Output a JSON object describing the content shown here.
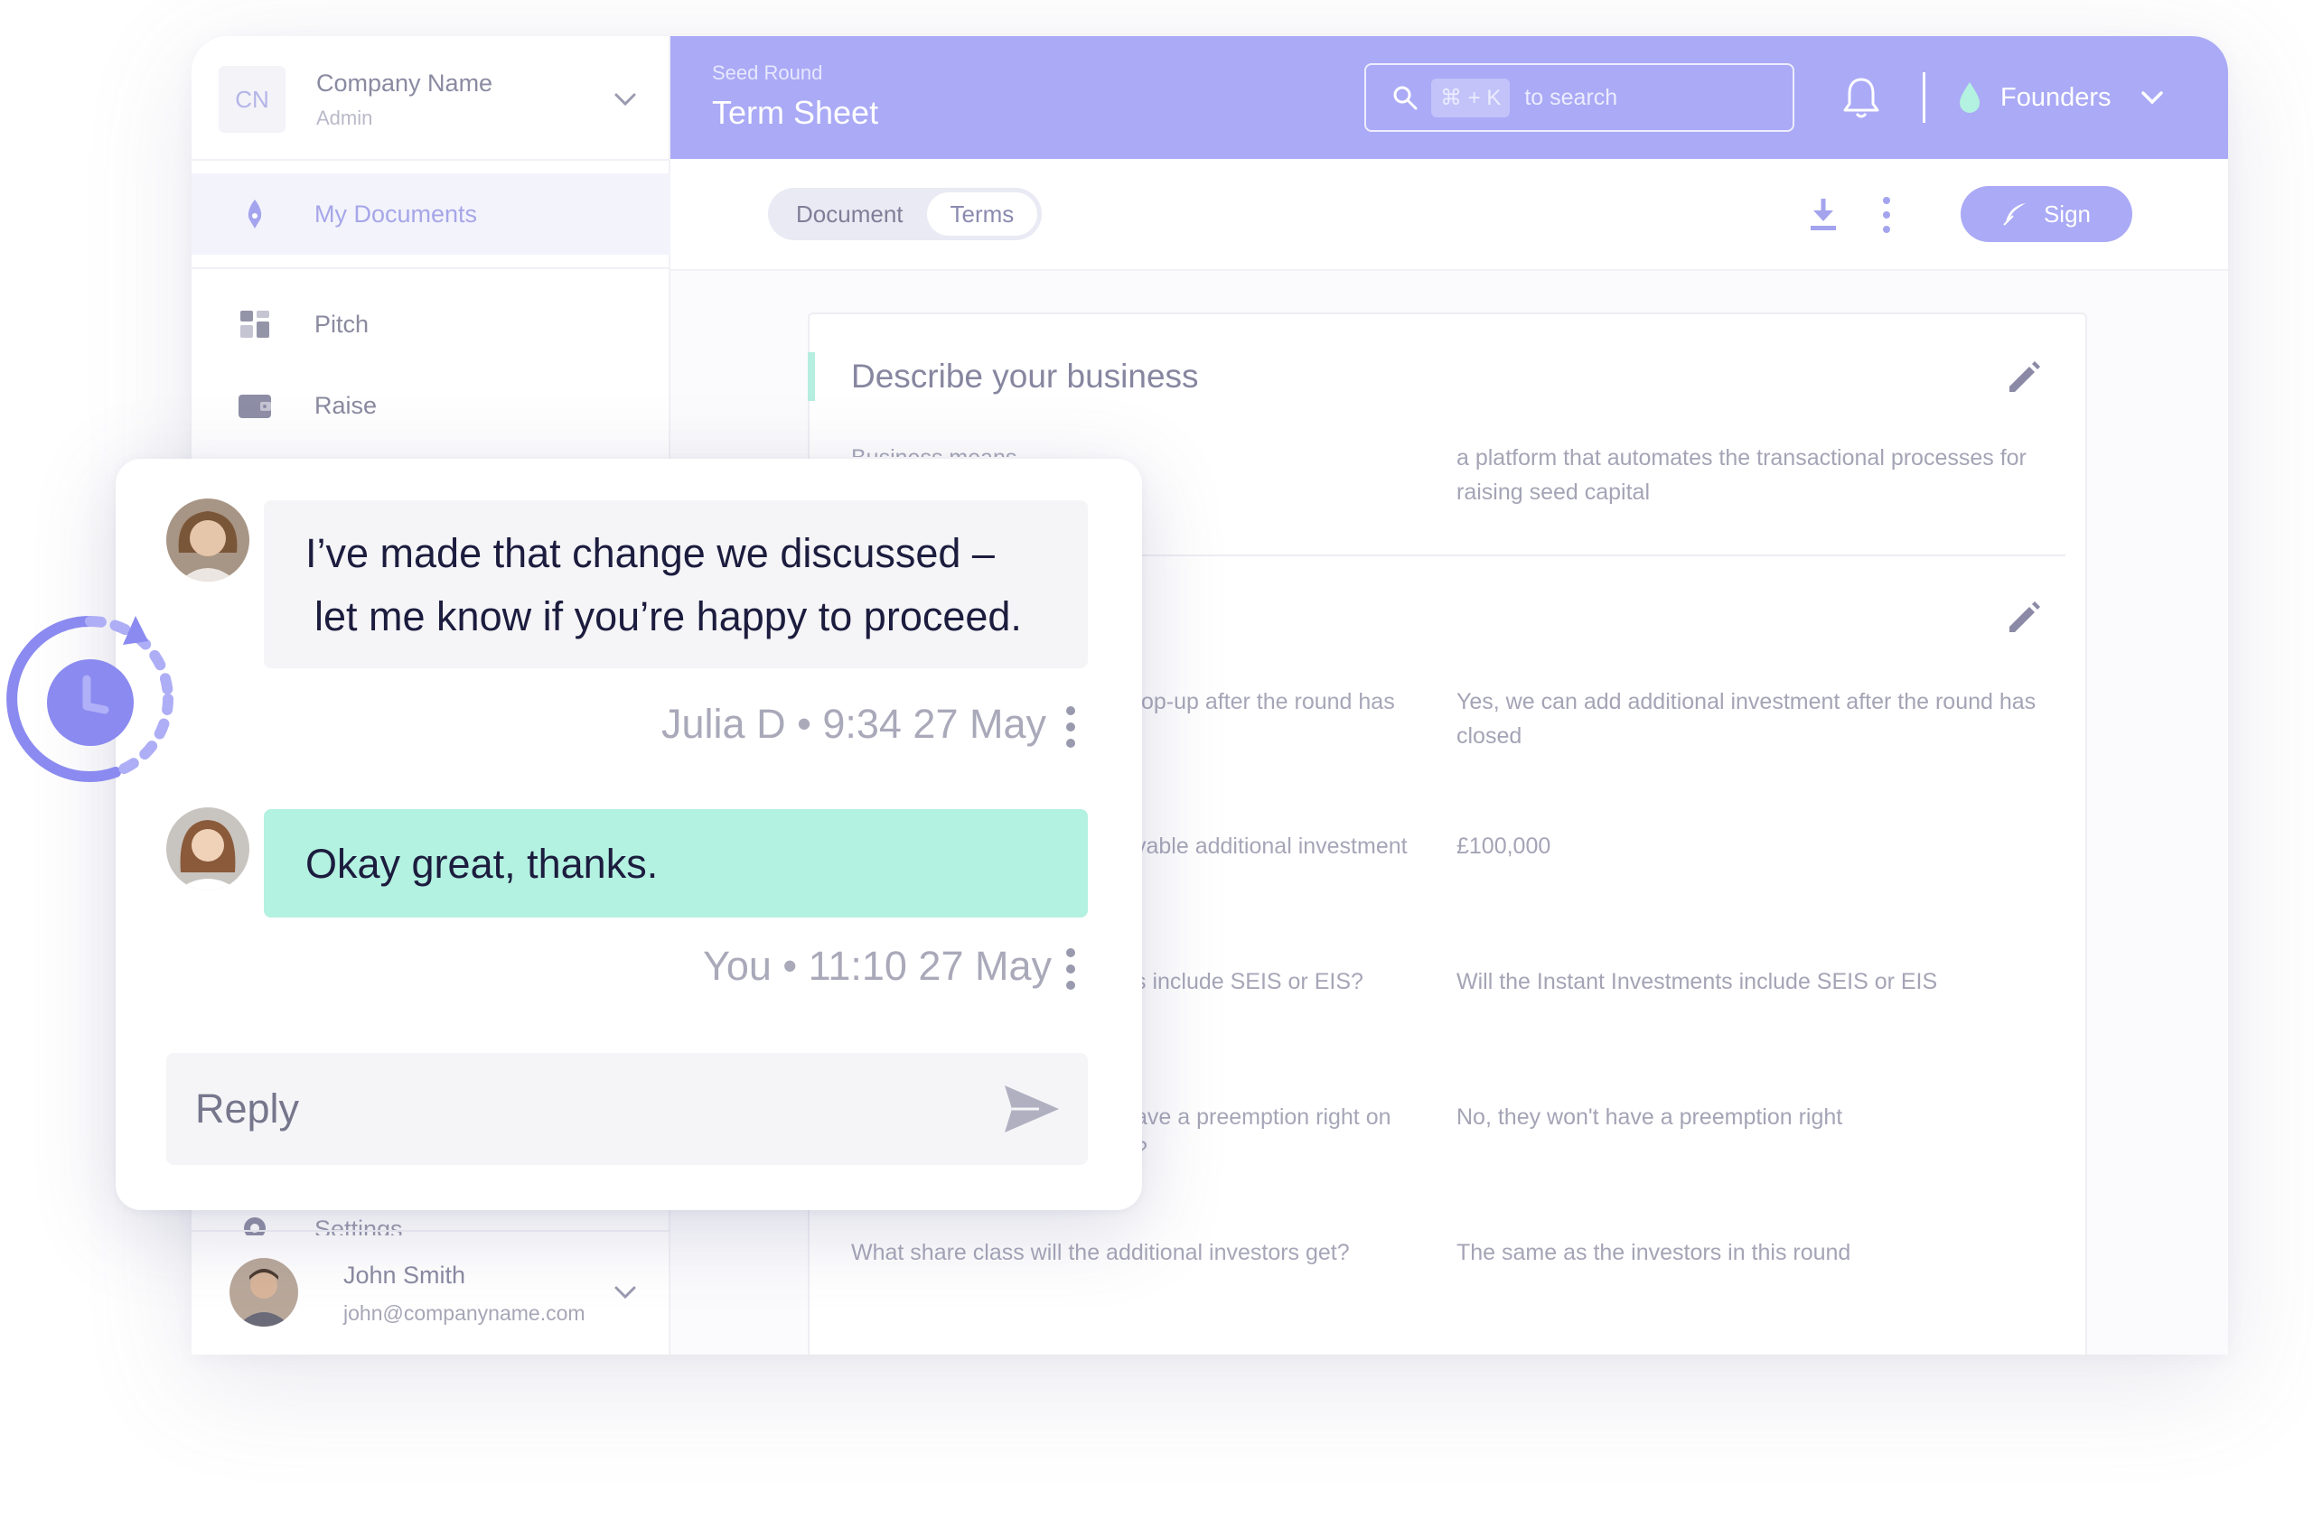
{
  "sidebar": {
    "company": {
      "initials": "CN",
      "name": "Company Name",
      "role": "Admin"
    },
    "items": [
      {
        "label": "My Documents",
        "icon": "pen-nib-icon",
        "active": true
      },
      {
        "label": "Pitch",
        "icon": "dashboard-icon",
        "active": false
      },
      {
        "label": "Raise",
        "icon": "wallet-icon",
        "active": false
      },
      {
        "label": "Settings",
        "icon": "gear-icon",
        "active": false
      }
    ],
    "user": {
      "name": "John Smith",
      "email": "john@companyname.com"
    }
  },
  "header": {
    "breadcrumb": "Seed Round",
    "title": "Term Sheet",
    "search": {
      "shortcut": "⌘ + K",
      "placeholder": "to search"
    },
    "account": "Founders"
  },
  "toolbar": {
    "tabs": [
      {
        "label": "Document",
        "active": false
      },
      {
        "label": "Terms",
        "active": true
      }
    ],
    "sign_label": "Sign"
  },
  "document": {
    "section_title": "Describe your business",
    "section_field_peek": "Business means",
    "section_answer": "a platform that automates the transactional processes for raising seed capital",
    "rows": [
      {
        "question": "top-up after the round has",
        "answer": "Yes, we can add additional investment after the round has closed"
      },
      {
        "question": "vable additional investment",
        "answer": "£100,000"
      },
      {
        "question": "s include SEIS or EIS?",
        "answer": "Will the Instant Investments include SEIS or EIS"
      },
      {
        "question": "ave a preemption right on",
        "question_line2": "?",
        "answer": "No, they won't have a preemption right"
      },
      {
        "question": "What share class will the additional investors get?",
        "answer": "The same as the investors in this round"
      }
    ]
  },
  "chat": {
    "messages": [
      {
        "text_line1": "I’ve made that change we discussed –",
        "text_line2": "let me know if you’re happy to proceed.",
        "meta": "Julia D • 9:34 27 May",
        "style": "gray"
      },
      {
        "text": "Okay great, thanks.",
        "meta": "You • 11:10 27 May",
        "style": "mint"
      }
    ],
    "reply_placeholder": "Reply"
  },
  "colors": {
    "accent": "#aaaaf6",
    "accent_dark": "#8a8af0",
    "mint": "#b3f1e0",
    "text_dark": "#1c1c3e"
  }
}
